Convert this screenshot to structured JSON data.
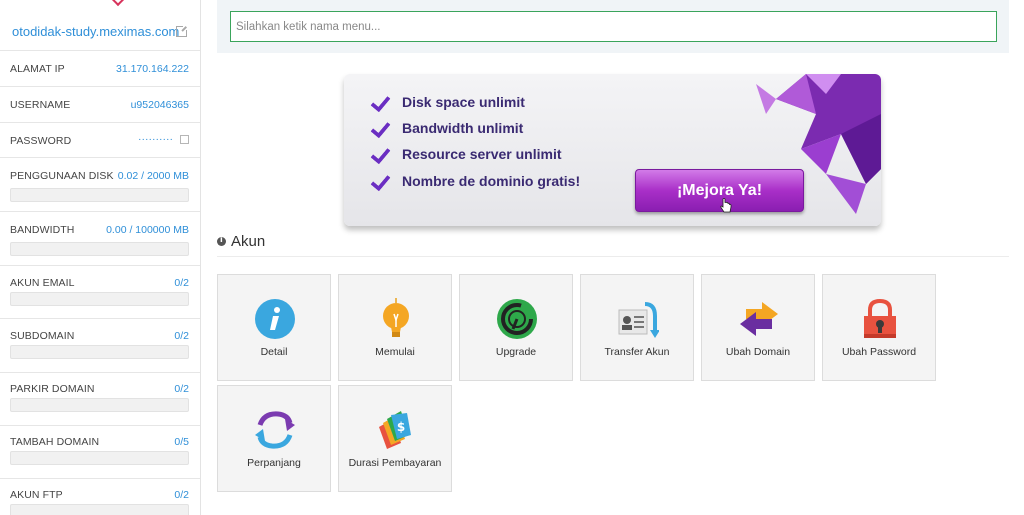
{
  "sidebar": {
    "site_link": "otodidak-study.meximas.com",
    "rows": [
      {
        "label": "ALAMAT IP",
        "value": "31.170.164.222"
      },
      {
        "label": "USERNAME",
        "value": "u952046365"
      },
      {
        "label": "PASSWORD",
        "value": "··········"
      },
      {
        "label": "PENGGUNAAN DISK",
        "value": "0.02 / 2000 MB",
        "fill": 0
      },
      {
        "label": "BANDWIDTH",
        "value": "0.00 / 100000 MB",
        "fill": 0
      },
      {
        "label": "AKUN EMAIL",
        "value": "0/2",
        "fill": 0
      },
      {
        "label": "SUBDOMAIN",
        "value": "0/2",
        "fill": 0
      },
      {
        "label": "PARKIR DOMAIN",
        "value": "0/2",
        "fill": 0
      },
      {
        "label": "TAMBAH DOMAIN",
        "value": "0/5",
        "fill": 0
      },
      {
        "label": "AKUN FTP",
        "value": "0/2",
        "fill": 0
      }
    ]
  },
  "search": {
    "placeholder": "Silahkan ketik nama menu..."
  },
  "banner": {
    "features": [
      "Disk space unlimit",
      "Bandwidth unlimit",
      "Resource server unlimit",
      "Nombre de dominio gratis!"
    ],
    "cta": "¡Mejora Ya!",
    "accent": "#a92fc8"
  },
  "section": {
    "title": "Akun"
  },
  "tiles": [
    {
      "label": "Detail",
      "icon": "info-icon"
    },
    {
      "label": "Memulai",
      "icon": "lightbulb-icon"
    },
    {
      "label": "Upgrade",
      "icon": "gauge-icon"
    },
    {
      "label": "Transfer Akun",
      "icon": "id-card-transfer-icon"
    },
    {
      "label": "Ubah Domain",
      "icon": "swap-arrows-icon"
    },
    {
      "label": "Ubah Password",
      "icon": "padlock-icon"
    },
    {
      "label": "Perpanjang",
      "icon": "renew-icon"
    },
    {
      "label": "Durasi Pembayaran",
      "icon": "price-tags-icon"
    }
  ]
}
